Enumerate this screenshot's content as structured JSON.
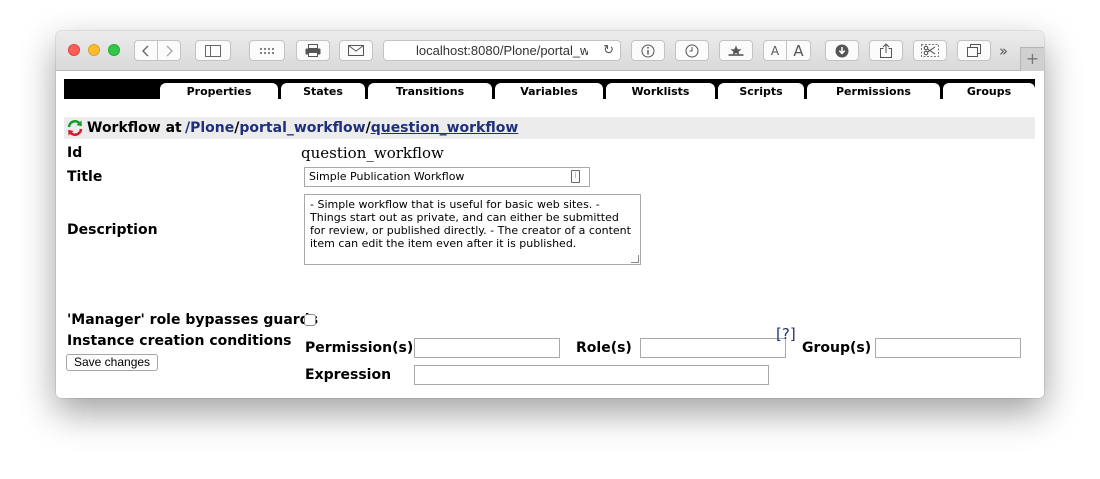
{
  "browser": {
    "url": "localhost:8080/Plone/portal_w",
    "text_size_small": "A",
    "text_size_large": "A",
    "overflow": "››",
    "new_tab": "+",
    "colors": {
      "close": "#fc5f57",
      "minimize": "#fdbc2e",
      "zoom": "#33c748"
    }
  },
  "tabs": [
    {
      "label": "Properties",
      "active": true
    },
    {
      "label": "States"
    },
    {
      "label": "Transitions"
    },
    {
      "label": "Variables"
    },
    {
      "label": "Worklists"
    },
    {
      "label": "Scripts"
    },
    {
      "label": "Permissions"
    },
    {
      "label": "Groups"
    }
  ],
  "header": {
    "label": "Workflow at",
    "breadcrumb": [
      "/Plone",
      "portal_workflow",
      "question_workflow"
    ],
    "separator": "/"
  },
  "form": {
    "id_label": "Id",
    "id_value": "question_workflow",
    "title_label": "Title",
    "title_value": "Simple Publication Workflow",
    "description_label": "Description",
    "description_value": "- Simple workflow that is useful for basic web sites. - Things start out as private, and can either be submitted for review, or published directly. - The creator of a content item can edit the item even after it is published.",
    "bypass_label": "'Manager' role bypasses guards",
    "bypass_checked": false,
    "instance_label": "Instance creation conditions",
    "permissions_label": "Permission(s)",
    "permissions_value": "",
    "roles_label": "Role(s)",
    "roles_value": "",
    "groups_label": "Group(s)",
    "groups_value": "",
    "expression_label": "Expression",
    "expression_value": "",
    "help_label": "[?]",
    "save_label": "Save changes"
  }
}
